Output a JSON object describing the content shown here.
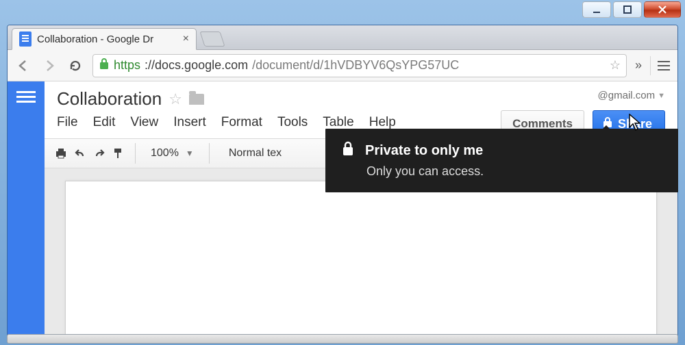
{
  "browser": {
    "tab_title": "Collaboration - Google Dr",
    "url_scheme": "https",
    "url_host": "://docs.google.com",
    "url_path": "/document/d/1hVDBYV6QsYPG57UC"
  },
  "account": {
    "email": "@gmail.com"
  },
  "doc": {
    "title": "Collaboration"
  },
  "menus": {
    "file": "File",
    "edit": "Edit",
    "view": "View",
    "insert": "Insert",
    "format": "Format",
    "tools": "Tools",
    "table": "Table",
    "help": "Help"
  },
  "actions": {
    "comments": "Comments",
    "share": "Share"
  },
  "toolbar": {
    "zoom": "100%",
    "paragraph_style": "Normal tex"
  },
  "tooltip": {
    "title": "Private to only me",
    "body": "Only you can access."
  }
}
